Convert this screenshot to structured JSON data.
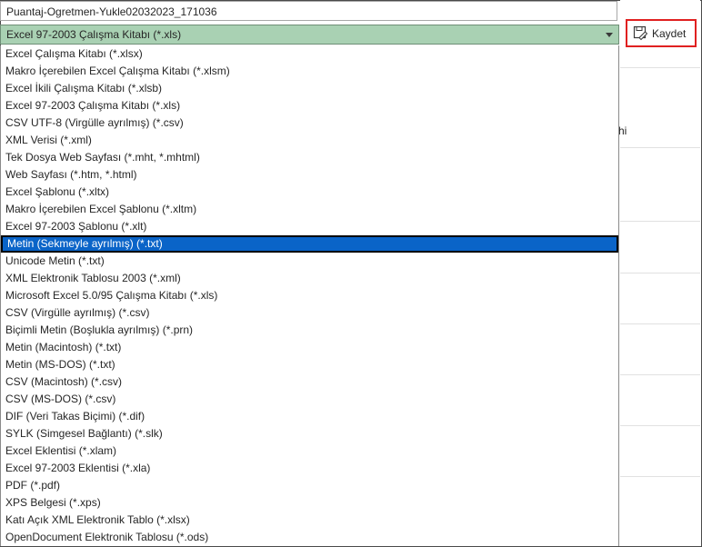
{
  "file_name": {
    "value": "Puantaj-Ogretmen-Yukle02032023_171036"
  },
  "save_type": {
    "selected": "Excel 97-2003 Çalışma Kitabı (*.xls)"
  },
  "save_button": {
    "label": "Kaydet"
  },
  "right_panel": {
    "fragment_text": "hi"
  },
  "file_types": [
    "Excel Çalışma Kitabı (*.xlsx)",
    "Makro İçerebilen Excel Çalışma Kitabı (*.xlsm)",
    "Excel İkili Çalışma Kitabı (*.xlsb)",
    "Excel 97-2003 Çalışma Kitabı (*.xls)",
    "CSV UTF-8 (Virgülle ayrılmış) (*.csv)",
    "XML Verisi (*.xml)",
    "Tek Dosya Web Sayfası (*.mht, *.mhtml)",
    "Web Sayfası (*.htm, *.html)",
    "Excel Şablonu (*.xltx)",
    "Makro İçerebilen Excel Şablonu (*.xltm)",
    "Excel 97-2003 Şablonu (*.xlt)",
    "Metin (Sekmeyle ayrılmış) (*.txt)",
    "Unicode Metin (*.txt)",
    "XML Elektronik Tablosu 2003 (*.xml)",
    "Microsoft Excel 5.0/95 Çalışma Kitabı (*.xls)",
    "CSV (Virgülle ayrılmış) (*.csv)",
    "Biçimli Metin (Boşlukla ayrılmış) (*.prn)",
    "Metin (Macintosh) (*.txt)",
    "Metin (MS-DOS) (*.txt)",
    "CSV (Macintosh) (*.csv)",
    "CSV (MS-DOS) (*.csv)",
    "DIF (Veri Takas Biçimi) (*.dif)",
    "SYLK (Simgesel Bağlantı) (*.slk)",
    "Excel Eklentisi (*.xlam)",
    "Excel 97-2003 Eklentisi (*.xla)",
    "PDF (*.pdf)",
    "XPS Belgesi (*.xps)",
    "Katı Açık XML Elektronik Tablo (*.xlsx)",
    "OpenDocument Elektronik Tablosu (*.ods)"
  ],
  "highlighted_index": 11,
  "colors": {
    "select_bg": "#a9d1b3",
    "highlight_bg": "#0a64c8",
    "save_outline": "#e02020"
  },
  "icons": {
    "save": "save-as-icon",
    "dropdown": "chevron-down-icon"
  }
}
